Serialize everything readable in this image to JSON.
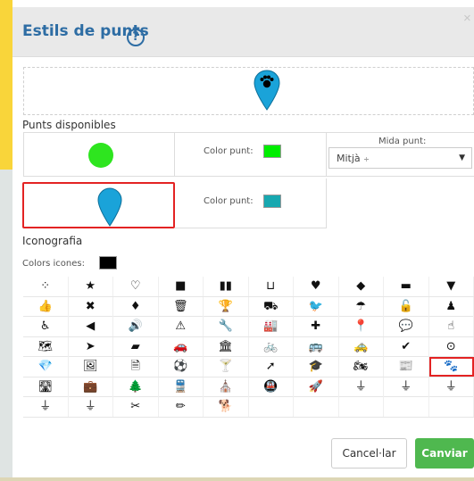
{
  "dialog": {
    "title": "Estils de punts",
    "help_glyph": "?",
    "close_glyph": "×"
  },
  "points": {
    "section_label": "Punts disponibles",
    "color_label": "Color punt:",
    "size_label": "Mida punt:",
    "size_value": "Mitjà",
    "size_caret": "▼",
    "dot_color": "#2ee51f",
    "swatch_1_color": "#00ee00",
    "swatch_2_color": "#17a8b0",
    "pin_color": "#1aa3d9"
  },
  "iconography": {
    "section_label": "Iconografia",
    "colors_label": "Colors icones:",
    "icon_color": "#000000",
    "rows": [
      [
        "⁘",
        "★",
        "♡",
        "■",
        "▮▮",
        "⊔",
        "♥",
        "◆",
        "▬",
        "▼"
      ],
      [
        "👍",
        "✖",
        "♦",
        "🗑",
        "🏆",
        "⛟",
        "🐦",
        "☂",
        "🔓",
        "♟"
      ],
      [
        "♿",
        "◀",
        "🔊",
        "⚠",
        "🔧",
        "🏭",
        "✚",
        "📍",
        "💬",
        "☝"
      ],
      [
        "🗺",
        "➤",
        "▰",
        "🚗",
        "🏛",
        "🚲",
        "🚌",
        "🚕",
        "✔",
        "⊙"
      ],
      [
        "💎",
        "🖼",
        "🗎",
        "⚽",
        "🍸",
        "➚",
        "🎓",
        "🏍",
        "📰",
        "🐾"
      ],
      [
        "🛣",
        "💼",
        "🌲",
        "🚆",
        "⛪",
        "🚇",
        "🚀",
        "⏚",
        "⏚",
        "⏚"
      ],
      [
        "⏚",
        "⏚",
        "✂",
        "✏",
        "🐕",
        "",
        "",
        "",
        "",
        ""
      ]
    ],
    "icon_names": [
      [
        "dots-icon",
        "star-icon",
        "heart-icon",
        "square-icon",
        "columns-icon",
        "cup-icon",
        "heart-solid-icon",
        "tag-icon",
        "table-icon",
        "arrow-down-icon"
      ],
      [
        "thumbs-up-icon",
        "close-icon",
        "drop-icon",
        "trash-icon",
        "trophy-icon",
        "truck-icon",
        "twitter-icon",
        "umbrella-icon",
        "unlock-icon",
        "user-icon"
      ],
      [
        "wheelchair-icon",
        "volume-low-icon",
        "volume-high-icon",
        "warning-icon",
        "wrench-icon",
        "industry-icon",
        "signpost-icon",
        "map-marker-icon",
        "comment-icon",
        "hand-pointer-icon"
      ],
      [
        "map-icon",
        "cursor-icon",
        "sticky-note-icon",
        "car-icon",
        "museum-icon",
        "bicycle-icon",
        "bus-icon",
        "taxi-icon",
        "check-circle-icon",
        "compass-icon"
      ],
      [
        "diamond-icon",
        "image-file-icon",
        "document-icon",
        "soccer-ball-icon",
        "cocktail-icon",
        "location-arrow-icon",
        "graduation-cap-icon",
        "motorcycle-icon",
        "newspaper-icon",
        "paw-icon"
      ],
      [
        "road-icon",
        "suitcase-icon",
        "tree-icon",
        "train-icon",
        "monument-icon",
        "subway-icon",
        "rocket-icon",
        "ground-icon",
        "ground-icon",
        "ground-icon"
      ],
      [
        "ground-icon",
        "ground-icon",
        "pen-icon",
        "brush-icon",
        "dog-icon",
        "",
        "",
        "",
        "",
        ""
      ]
    ],
    "selected_icon": "paw-icon"
  },
  "actions": {
    "cancel_label": "Cancel·lar",
    "ok_label": "Canviar"
  }
}
